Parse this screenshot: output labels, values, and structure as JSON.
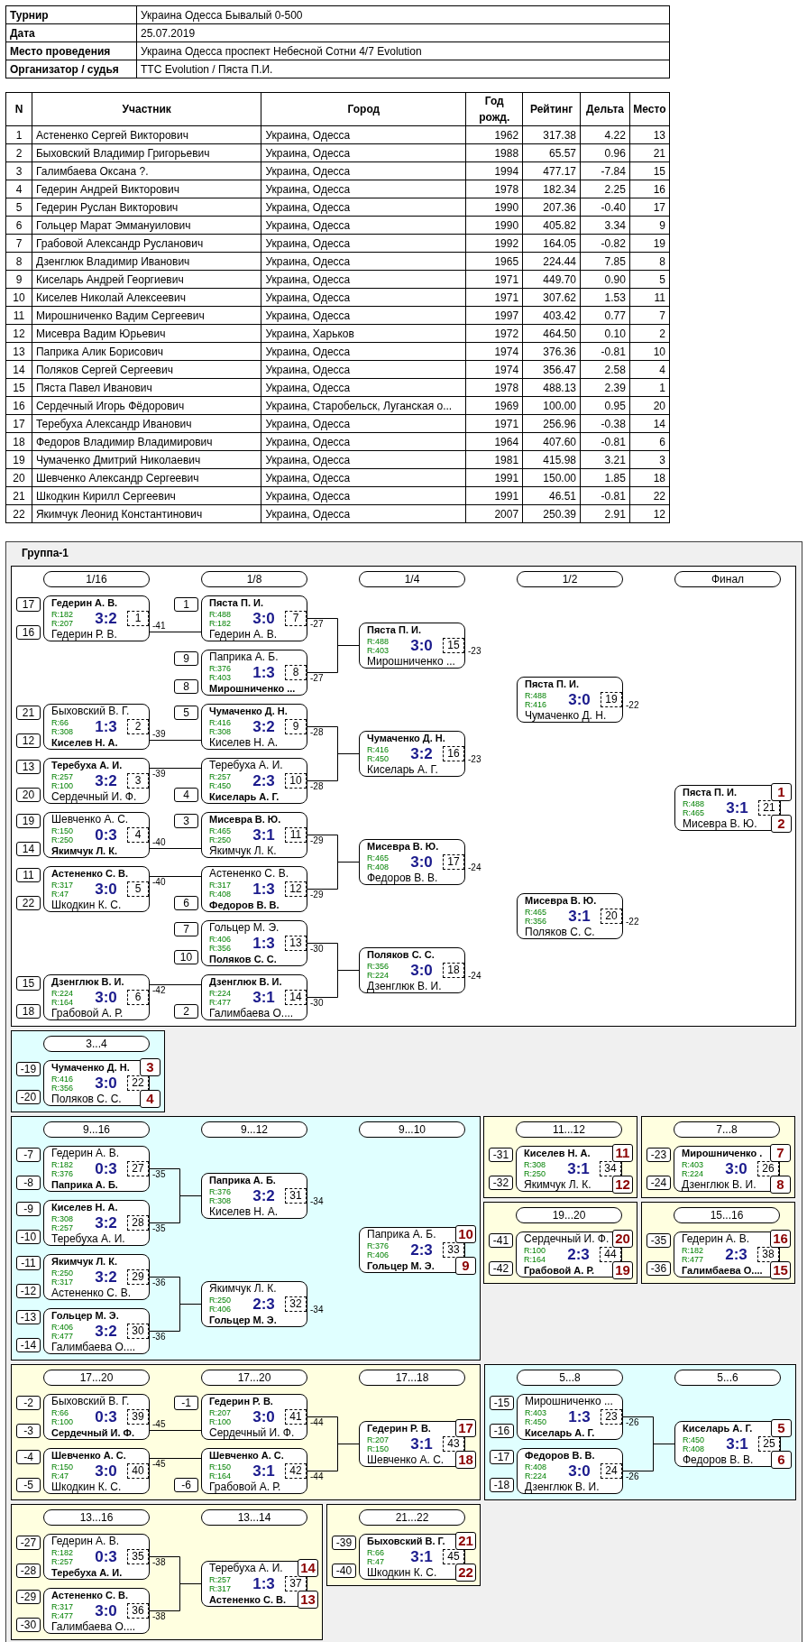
{
  "info": [
    {
      "label": "Турнир",
      "value": "Украина Одесса Бывалый 0-500"
    },
    {
      "label": "Дата",
      "value": "25.07.2019"
    },
    {
      "label": "Место проведения",
      "value": "Украина Одесса проспект Небесной Сотни 4/7 Evolution"
    },
    {
      "label": "Организатор / судья",
      "value": "TTC Evolution / Пяста П.И."
    }
  ],
  "participants": {
    "columns": [
      "N",
      "Участник",
      "Город",
      "Год рожд.",
      "Рейтинг",
      "Дельта",
      "Место"
    ],
    "rows": [
      [
        "1",
        "Астененко Сергей Викторович",
        "Украина, Одесса",
        "1962",
        "317.38",
        "4.22",
        "13"
      ],
      [
        "2",
        "Быховский Владимир Григорьевич",
        "Украина, Одесса",
        "1988",
        "65.57",
        "0.96",
        "21"
      ],
      [
        "3",
        "Галимбаева Оксана ?.",
        "Украина, Одесса",
        "1994",
        "477.17",
        "-7.84",
        "15"
      ],
      [
        "4",
        "Гедерин Андрей Викторович",
        "Украина, Одесса",
        "1978",
        "182.34",
        "2.25",
        "16"
      ],
      [
        "5",
        "Гедерин Руслан Викторович",
        "Украина, Одесса",
        "1990",
        "207.36",
        "-0.40",
        "17"
      ],
      [
        "6",
        "Гольцер Марат Эммануилович",
        "Украина, Одесса",
        "1990",
        "405.82",
        "3.34",
        "9"
      ],
      [
        "7",
        "Грабовой Александр Русланович",
        "Украина, Одесса",
        "1992",
        "164.05",
        "-0.82",
        "19"
      ],
      [
        "8",
        "Дзенглюк Владимир Иванович",
        "Украина, Одесса",
        "1965",
        "224.44",
        "7.85",
        "8"
      ],
      [
        "9",
        "Киселарь Андрей Георгиевич",
        "Украина, Одесса",
        "1971",
        "449.70",
        "0.90",
        "5"
      ],
      [
        "10",
        "Киселев Николай Алексеевич",
        "Украина, Одесса",
        "1971",
        "307.62",
        "1.53",
        "11"
      ],
      [
        "11",
        "Мирошниченко Вадим Сергеевич",
        "Украина, Одесса",
        "1997",
        "403.42",
        "0.77",
        "7"
      ],
      [
        "12",
        "Мисевра Вадим Юрьевич",
        "Украина, Харьков",
        "1972",
        "464.50",
        "0.10",
        "2"
      ],
      [
        "13",
        "Паприка Алик Борисович",
        "Украина, Одесса",
        "1974",
        "376.36",
        "-0.81",
        "10"
      ],
      [
        "14",
        "Поляков Сергей Сергеевич",
        "Украина, Одесса",
        "1974",
        "356.47",
        "2.58",
        "4"
      ],
      [
        "15",
        "Пяста Павел Иванович",
        "Украина, Одесса",
        "1978",
        "488.13",
        "2.39",
        "1"
      ],
      [
        "16",
        "Сердечный Игорь Фёдорович",
        "Украина, Старобельск, Луганская о...",
        "1969",
        "100.00",
        "0.95",
        "20"
      ],
      [
        "17",
        "Теребуха Александр Иванович",
        "Украина, Одесса",
        "1971",
        "256.96",
        "-0.38",
        "14"
      ],
      [
        "18",
        "Федоров Владимир Владимирович",
        "Украина, Одесса",
        "1964",
        "407.60",
        "-0.81",
        "6"
      ],
      [
        "19",
        "Чумаченко Дмитрий Николаевич",
        "Украина, Одесса",
        "1981",
        "415.98",
        "3.21",
        "3"
      ],
      [
        "20",
        "Шевченко Александр Сергеевич",
        "Украина, Одесса",
        "1991",
        "150.00",
        "1.85",
        "18"
      ],
      [
        "21",
        "Шкодкин Кирилл Сергеевич",
        "Украина, Одесса",
        "1991",
        "46.51",
        "-0.81",
        "22"
      ],
      [
        "22",
        "Якимчук Леонид Константинович",
        "Украина, Одесса",
        "2007",
        "250.39",
        "2.91",
        "12"
      ]
    ]
  },
  "group": {
    "title": "Группа-1",
    "sections": [
      {
        "color": "#ffffff",
        "rounds": [
          {
            "label": "1/16",
            "matches": [
              {
                "number": "1",
                "score": "3:2",
                "loser_to": "-41",
                "players": [
                  {
                    "name": "Гедерин А. В.",
                    "rating": "R:182",
                    "seed": "17",
                    "winner": true
                  },
                  {
                    "name": "Гедерин Р. В.",
                    "rating": "R:207",
                    "seed": "16",
                    "winner": false
                  }
                ]
              },
              {
                "number": "2",
                "score": "1:3",
                "loser_to": "-39",
                "players": [
                  {
                    "name": "Быховский В. Г.",
                    "rating": "R:66",
                    "seed": "21",
                    "winner": false
                  },
                  {
                    "name": "Киселев Н. А.",
                    "rating": "R:308",
                    "seed": "12",
                    "winner": true
                  }
                ]
              },
              {
                "number": "3",
                "score": "3:2",
                "loser_to": "-39",
                "players": [
                  {
                    "name": "Теребуха А. И.",
                    "rating": "R:257",
                    "seed": "13",
                    "winner": true
                  },
                  {
                    "name": "Сердечный И. Ф.",
                    "rating": "R:100",
                    "seed": "20",
                    "winner": false
                  }
                ]
              },
              {
                "number": "4",
                "score": "0:3",
                "loser_to": "-40",
                "players": [
                  {
                    "name": "Шевченко А. С.",
                    "rating": "R:150",
                    "seed": "19",
                    "winner": false
                  },
                  {
                    "name": "Якимчук Л. К.",
                    "rating": "R:250",
                    "seed": "14",
                    "winner": true
                  }
                ]
              },
              {
                "number": "5",
                "score": "3:0",
                "loser_to": "-40",
                "players": [
                  {
                    "name": "Астененко С. В.",
                    "rating": "R:317",
                    "seed": "11",
                    "winner": true
                  },
                  {
                    "name": "Шкодкин К. С.",
                    "rating": "R:47",
                    "seed": "22",
                    "winner": false
                  }
                ]
              },
              {
                "number": "6",
                "score": "3:0",
                "loser_to": "-42",
                "players": [
                  {
                    "name": "Дзенглюк В. И.",
                    "rating": "R:224",
                    "seed": "15",
                    "winner": true
                  },
                  {
                    "name": "Грабовой А. Р.",
                    "rating": "R:164",
                    "seed": "18",
                    "winner": false
                  }
                ]
              }
            ]
          },
          {
            "label": "1/8",
            "matches": [
              {
                "number": "7",
                "score": "3:0",
                "loser_to": "-27",
                "players": [
                  {
                    "name": "Пяста П. И.",
                    "rating": "R:488",
                    "seed": "1",
                    "winner": true
                  },
                  {
                    "name": "Гедерин А. В.",
                    "rating": "R:182",
                    "winner": false
                  }
                ]
              },
              {
                "number": "8",
                "score": "1:3",
                "loser_to": "-27",
                "players": [
                  {
                    "name": "Паприка А. Б.",
                    "rating": "R:376",
                    "seed": "9",
                    "winner": false
                  },
                  {
                    "name": "Мирошниченко ...",
                    "rating": "R:403",
                    "seed": "8",
                    "winner": true
                  }
                ]
              },
              {
                "number": "9",
                "score": "3:2",
                "loser_to": "-28",
                "players": [
                  {
                    "name": "Чумаченко Д. Н.",
                    "rating": "R:416",
                    "seed": "5",
                    "winner": true
                  },
                  {
                    "name": "Киселев Н. А.",
                    "rating": "R:308",
                    "winner": false
                  }
                ]
              },
              {
                "number": "10",
                "score": "2:3",
                "loser_to": "-28",
                "players": [
                  {
                    "name": "Теребуха А. И.",
                    "rating": "R:257",
                    "winner": false
                  },
                  {
                    "name": "Киселарь А. Г.",
                    "rating": "R:450",
                    "seed": "4",
                    "winner": true
                  }
                ]
              },
              {
                "number": "11",
                "score": "3:1",
                "loser_to": "-29",
                "players": [
                  {
                    "name": "Мисевра В. Ю.",
                    "rating": "R:465",
                    "seed": "3",
                    "winner": true
                  },
                  {
                    "name": "Якимчук Л. К.",
                    "rating": "R:250",
                    "winner": false
                  }
                ]
              },
              {
                "number": "12",
                "score": "1:3",
                "loser_to": "-29",
                "players": [
                  {
                    "name": "Астененко С. В.",
                    "rating": "R:317",
                    "winner": false
                  },
                  {
                    "name": "Федоров В. В.",
                    "rating": "R:408",
                    "seed": "6",
                    "winner": true
                  }
                ]
              },
              {
                "number": "13",
                "score": "1:3",
                "loser_to": "-30",
                "players": [
                  {
                    "name": "Гольцер М. Э.",
                    "rating": "R:406",
                    "seed": "7",
                    "winner": false
                  },
                  {
                    "name": "Поляков С. С.",
                    "rating": "R:356",
                    "seed": "10",
                    "winner": true
                  }
                ]
              },
              {
                "number": "14",
                "score": "3:1",
                "loser_to": "-30",
                "players": [
                  {
                    "name": "Дзенглюк В. И.",
                    "rating": "R:224",
                    "winner": true
                  },
                  {
                    "name": "Галимбаева О....",
                    "rating": "R:477",
                    "seed": "2",
                    "winner": false
                  }
                ]
              }
            ]
          },
          {
            "label": "1/4",
            "matches": [
              {
                "number": "15",
                "score": "3:0",
                "loser_to": "-23",
                "players": [
                  {
                    "name": "Пяста П. И.",
                    "rating": "R:488",
                    "winner": true
                  },
                  {
                    "name": "Мирошниченко ...",
                    "rating": "R:403",
                    "winner": false
                  }
                ]
              },
              {
                "number": "16",
                "score": "3:2",
                "loser_to": "-23",
                "players": [
                  {
                    "name": "Чумаченко Д. Н.",
                    "rating": "R:416",
                    "winner": true
                  },
                  {
                    "name": "Киселарь А. Г.",
                    "rating": "R:450",
                    "winner": false
                  }
                ]
              },
              {
                "number": "17",
                "score": "3:0",
                "loser_to": "-24",
                "players": [
                  {
                    "name": "Мисевра В. Ю.",
                    "rating": "R:465",
                    "winner": true
                  },
                  {
                    "name": "Федоров В. В.",
                    "rating": "R:408",
                    "winner": false
                  }
                ]
              },
              {
                "number": "18",
                "score": "3:0",
                "loser_to": "-24",
                "players": [
                  {
                    "name": "Поляков С. С.",
                    "rating": "R:356",
                    "winner": true
                  },
                  {
                    "name": "Дзенглюк В. И.",
                    "rating": "R:224",
                    "winner": false
                  }
                ]
              }
            ]
          },
          {
            "label": "1/2",
            "matches": [
              {
                "number": "19",
                "score": "3:0",
                "loser_to": "-22",
                "players": [
                  {
                    "name": "Пяста П. И.",
                    "rating": "R:488",
                    "winner": true
                  },
                  {
                    "name": "Чумаченко Д. Н.",
                    "rating": "R:416",
                    "winner": false
                  }
                ]
              },
              {
                "number": "20",
                "score": "3:1",
                "loser_to": "-22",
                "players": [
                  {
                    "name": "Мисевра В. Ю.",
                    "rating": "R:465",
                    "winner": true
                  },
                  {
                    "name": "Поляков С. С.",
                    "rating": "R:356",
                    "winner": false
                  }
                ]
              }
            ]
          },
          {
            "label": "Финал",
            "matches": [
              {
                "number": "21",
                "score": "3:1",
                "places": [
                  "1",
                  "2"
                ],
                "players": [
                  {
                    "name": "Пяста П. И.",
                    "rating": "R:488",
                    "winner": true
                  },
                  {
                    "name": "Мисевра В. Ю.",
                    "rating": "R:465",
                    "winner": false
                  }
                ]
              }
            ]
          }
        ]
      },
      {
        "color": "#e0ffff",
        "rounds": [
          {
            "label": "3...4",
            "matches": [
              {
                "number": "22",
                "score": "3:0",
                "places": [
                  "3",
                  "4"
                ],
                "players": [
                  {
                    "name": "Чумаченко Д. Н.",
                    "rating": "R:416",
                    "seed": "-19",
                    "winner": true
                  },
                  {
                    "name": "Поляков С. С.",
                    "rating": "R:356",
                    "seed": "-20",
                    "winner": false
                  }
                ]
              }
            ]
          }
        ]
      },
      {
        "color": "#e0ffff",
        "rounds": [
          {
            "label": "9...16",
            "matches": [
              {
                "number": "27",
                "score": "0:3",
                "loser_to": "-35",
                "players": [
                  {
                    "name": "Гедерин А. В.",
                    "rating": "R:182",
                    "seed": "-7",
                    "winner": false
                  },
                  {
                    "name": "Паприка А. Б.",
                    "rating": "R:376",
                    "seed": "-8",
                    "winner": true
                  }
                ]
              },
              {
                "number": "28",
                "score": "3:2",
                "loser_to": "-35",
                "players": [
                  {
                    "name": "Киселев Н. А.",
                    "rating": "R:308",
                    "seed": "-9",
                    "winner": true
                  },
                  {
                    "name": "Теребуха А. И.",
                    "rating": "R:257",
                    "seed": "-10",
                    "winner": false
                  }
                ]
              },
              {
                "number": "29",
                "score": "3:2",
                "loser_to": "-36",
                "players": [
                  {
                    "name": "Якимчук Л. К.",
                    "rating": "R:250",
                    "seed": "-11",
                    "winner": true
                  },
                  {
                    "name": "Астененко С. В.",
                    "rating": "R:317",
                    "seed": "-12",
                    "winner": false
                  }
                ]
              },
              {
                "number": "30",
                "score": "3:2",
                "loser_to": "-36",
                "players": [
                  {
                    "name": "Гольцер М. Э.",
                    "rating": "R:406",
                    "seed": "-13",
                    "winner": true
                  },
                  {
                    "name": "Галимбаева О....",
                    "rating": "R:477",
                    "seed": "-14",
                    "winner": false
                  }
                ]
              }
            ]
          },
          {
            "label": "9...12",
            "matches": [
              {
                "number": "31",
                "score": "3:2",
                "loser_to": "-34",
                "players": [
                  {
                    "name": "Паприка А. Б.",
                    "rating": "R:376",
                    "winner": true
                  },
                  {
                    "name": "Киселев Н. А.",
                    "rating": "R:308",
                    "winner": false
                  }
                ]
              },
              {
                "number": "32",
                "score": "2:3",
                "loser_to": "-34",
                "players": [
                  {
                    "name": "Якимчук Л. К.",
                    "rating": "R:250",
                    "winner": false
                  },
                  {
                    "name": "Гольцер М. Э.",
                    "rating": "R:406",
                    "winner": true
                  }
                ]
              }
            ]
          },
          {
            "label": "9...10",
            "matches": [
              {
                "number": "33",
                "score": "2:3",
                "places": [
                  "10",
                  "9"
                ],
                "players": [
                  {
                    "name": "Паприка А. Б.",
                    "rating": "R:376",
                    "winner": false
                  },
                  {
                    "name": "Гольцер М. Э.",
                    "rating": "R:406",
                    "winner": true
                  }
                ]
              }
            ]
          }
        ]
      },
      {
        "color": "#ffffe0",
        "rounds": [
          {
            "label": "11...12",
            "matches": [
              {
                "number": "34",
                "score": "3:1",
                "places": [
                  "11",
                  "12"
                ],
                "players": [
                  {
                    "name": "Киселев Н. А.",
                    "rating": "R:308",
                    "seed": "-31",
                    "winner": true
                  },
                  {
                    "name": "Якимчук Л. К.",
                    "rating": "R:250",
                    "seed": "-32",
                    "winner": false
                  }
                ]
              }
            ]
          }
        ]
      },
      {
        "color": "#ffffe0",
        "rounds": [
          {
            "label": "7...8",
            "matches": [
              {
                "number": "26",
                "score": "3:0",
                "places": [
                  "7",
                  "8"
                ],
                "players": [
                  {
                    "name": "Мирошниченко .",
                    "rating": "R:403",
                    "seed": "-23",
                    "winner": true
                  },
                  {
                    "name": "Дзенглюк В. И.",
                    "rating": "R:224",
                    "seed": "-24",
                    "winner": false
                  }
                ]
              }
            ]
          }
        ]
      },
      {
        "color": "#ffffe0",
        "rounds": [
          {
            "label": "19...20",
            "matches": [
              {
                "number": "44",
                "score": "2:3",
                "places": [
                  "20",
                  "19"
                ],
                "players": [
                  {
                    "name": "Сердечный И. Ф.",
                    "rating": "R:100",
                    "seed": "-41",
                    "winner": false
                  },
                  {
                    "name": "Грабовой А. Р.",
                    "rating": "R:164",
                    "seed": "-42",
                    "winner": true
                  }
                ]
              }
            ]
          }
        ]
      },
      {
        "color": "#ffffe0",
        "rounds": [
          {
            "label": "15...16",
            "matches": [
              {
                "number": "38",
                "score": "2:3",
                "places": [
                  "16",
                  "15"
                ],
                "players": [
                  {
                    "name": "Гедерин А. В.",
                    "rating": "R:182",
                    "seed": "-35",
                    "winner": false
                  },
                  {
                    "name": "Галимбаева О....",
                    "rating": "R:477",
                    "seed": "-36",
                    "winner": true
                  }
                ]
              }
            ]
          }
        ]
      },
      {
        "color": "#ffffe0",
        "rounds": [
          {
            "label": "17...20",
            "matches": [
              {
                "number": "39",
                "score": "0:3",
                "loser_to": "-45",
                "players": [
                  {
                    "name": "Быховский В. Г.",
                    "rating": "R:66",
                    "seed": "-2",
                    "winner": false
                  },
                  {
                    "name": "Сердечный И. Ф.",
                    "rating": "R:100",
                    "seed": "-3",
                    "winner": true
                  }
                ]
              },
              {
                "number": "40",
                "score": "3:0",
                "loser_to": "-45",
                "players": [
                  {
                    "name": "Шевченко А. С.",
                    "rating": "R:150",
                    "seed": "-4",
                    "winner": true
                  },
                  {
                    "name": "Шкодкин К. С.",
                    "rating": "R:47",
                    "seed": "-5",
                    "winner": false
                  }
                ]
              }
            ]
          },
          {
            "label": "17...20",
            "matches": [
              {
                "number": "41",
                "score": "3:0",
                "loser_to": "-44",
                "players": [
                  {
                    "name": "Гедерин Р. В.",
                    "rating": "R:207",
                    "seed": "-1",
                    "winner": true
                  },
                  {
                    "name": "Сердечный И. Ф.",
                    "rating": "R:100",
                    "winner": false
                  }
                ]
              },
              {
                "number": "42",
                "score": "3:1",
                "loser_to": "-44",
                "players": [
                  {
                    "name": "Шевченко А. С.",
                    "rating": "R:150",
                    "winner": true
                  },
                  {
                    "name": "Грабовой А. Р.",
                    "rating": "R:164",
                    "seed": "-6",
                    "winner": false
                  }
                ]
              }
            ]
          },
          {
            "label": "17...18",
            "matches": [
              {
                "number": "43",
                "score": "3:1",
                "places": [
                  "17",
                  "18"
                ],
                "players": [
                  {
                    "name": "Гедерин Р. В.",
                    "rating": "R:207",
                    "winner": true
                  },
                  {
                    "name": "Шевченко А. С.",
                    "rating": "R:150",
                    "winner": false
                  }
                ]
              }
            ]
          }
        ]
      },
      {
        "color": "#e0ffff",
        "rounds": [
          {
            "label": "5...8",
            "matches": [
              {
                "number": "23",
                "score": "1:3",
                "loser_to": "-26",
                "players": [
                  {
                    "name": "Мирошниченко ...",
                    "rating": "R:403",
                    "seed": "-15",
                    "winner": false
                  },
                  {
                    "name": "Киселарь А. Г.",
                    "rating": "R:450",
                    "seed": "-16",
                    "winner": true
                  }
                ]
              },
              {
                "number": "24",
                "score": "3:0",
                "loser_to": "-26",
                "players": [
                  {
                    "name": "Федоров В. В.",
                    "rating": "R:408",
                    "seed": "-17",
                    "winner": true
                  },
                  {
                    "name": "Дзенглюк В. И.",
                    "rating": "R:224",
                    "seed": "-18",
                    "winner": false
                  }
                ]
              }
            ]
          },
          {
            "label": "5...6",
            "matches": [
              {
                "number": "25",
                "score": "3:1",
                "places": [
                  "5",
                  "6"
                ],
                "players": [
                  {
                    "name": "Киселарь А. Г.",
                    "rating": "R:450",
                    "winner": true
                  },
                  {
                    "name": "Федоров В. В.",
                    "rating": "R:408",
                    "winner": false
                  }
                ]
              }
            ]
          }
        ]
      },
      {
        "color": "#ffffe0",
        "rounds": [
          {
            "label": "13...16",
            "matches": [
              {
                "number": "35",
                "score": "0:3",
                "loser_to": "-38",
                "players": [
                  {
                    "name": "Гедерин А. В.",
                    "rating": "R:182",
                    "seed": "-27",
                    "winner": false
                  },
                  {
                    "name": "Теребуха А. И.",
                    "rating": "R:257",
                    "seed": "-28",
                    "winner": true
                  }
                ]
              },
              {
                "number": "36",
                "score": "3:0",
                "loser_to": "-38",
                "players": [
                  {
                    "name": "Астененко С. В.",
                    "rating": "R:317",
                    "seed": "-29",
                    "winner": true
                  },
                  {
                    "name": "Галимбаева О....",
                    "rating": "R:477",
                    "seed": "-30",
                    "winner": false
                  }
                ]
              }
            ]
          },
          {
            "label": "13...14",
            "matches": [
              {
                "number": "37",
                "score": "1:3",
                "places": [
                  "14",
                  "13"
                ],
                "players": [
                  {
                    "name": "Теребуха А. И.",
                    "rating": "R:257",
                    "winner": false
                  },
                  {
                    "name": "Астененко С. В.",
                    "rating": "R:317",
                    "winner": true
                  }
                ]
              }
            ]
          }
        ]
      },
      {
        "color": "#ffffe0",
        "rounds": [
          {
            "label": "21...22",
            "matches": [
              {
                "number": "45",
                "score": "3:1",
                "places": [
                  "21",
                  "22"
                ],
                "players": [
                  {
                    "name": "Быховский В. Г.",
                    "rating": "R:66",
                    "seed": "-39",
                    "winner": true
                  },
                  {
                    "name": "Шкодкин К. С.",
                    "rating": "R:47",
                    "seed": "-40",
                    "winner": false
                  }
                ]
              }
            ]
          }
        ]
      }
    ]
  }
}
